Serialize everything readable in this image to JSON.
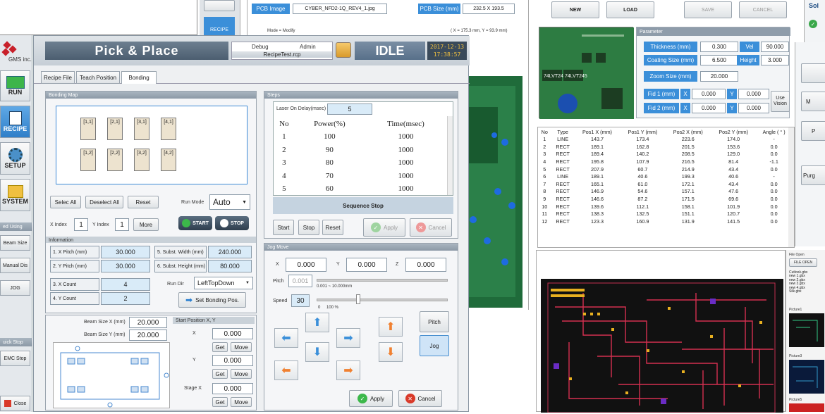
{
  "top_strip": {
    "pcb_image_label": "PCB Image",
    "pcb_image_value": "CYBER_NFD2-1Q_REV4_1.jpg",
    "pcb_size_label": "PCB Size (mm)",
    "pcb_size_value": "232.5 X 193.5",
    "mode": "Mode = Modify",
    "coords": "( X = 175.3 mm, Y = 93.9 mm)"
  },
  "left_sidebar_top": {
    "recipe": "RECIPE"
  },
  "right_toolbar": {
    "new": "NEW",
    "load": "LOAD",
    "save": "SAVE",
    "cancel": "CANCEL",
    "sol": "Sol"
  },
  "parameter": {
    "title": "Parameter",
    "thickness_label": "Thickness (mm)",
    "thickness": "0.300",
    "vel_label": "Vel",
    "vel": "90.000",
    "coating_label": "Coating Size (mm)",
    "coating": "6.500",
    "height_label": "Height",
    "height": "3.000",
    "zoom_label": "Zoom Size (mm)",
    "zoom": "20.000",
    "fid1": "Fid 1 (mm)",
    "fid2": "Fid 2 (mm)",
    "x": "X",
    "y": "Y",
    "fid1x": "0.000",
    "fid1y": "0.000",
    "fid2x": "0.000",
    "fid2y": "0.000",
    "use_vision": "Use Vision"
  },
  "coord_table": {
    "headers": [
      "No",
      "Type",
      "Pos1 X (mm)",
      "Pos1 Y (mm)",
      "Pos2 X (mm)",
      "Pos2 Y (mm)",
      "Angle ( ° )"
    ],
    "rows": [
      [
        "1",
        "LINE",
        "143.7",
        "173.4",
        "223.6",
        "174.0",
        "-"
      ],
      [
        "2",
        "RECT",
        "189.1",
        "162.8",
        "201.5",
        "153.6",
        "0.0"
      ],
      [
        "3",
        "RECT",
        "189.4",
        "140.2",
        "208.5",
        "129.0",
        "0.0"
      ],
      [
        "4",
        "RECT",
        "195.8",
        "107.9",
        "216.5",
        "81.4",
        "-1.1"
      ],
      [
        "5",
        "RECT",
        "207.9",
        "60.7",
        "214.9",
        "43.4",
        "0.0"
      ],
      [
        "6",
        "LINE",
        "189.1",
        "40.6",
        "199.3",
        "40.6",
        "-"
      ],
      [
        "7",
        "RECT",
        "165.1",
        "61.0",
        "172.1",
        "43.4",
        "0.0"
      ],
      [
        "8",
        "RECT",
        "146.9",
        "54.6",
        "157.1",
        "47.6",
        "0.0"
      ],
      [
        "9",
        "RECT",
        "146.6",
        "87.2",
        "171.5",
        "69.6",
        "0.0"
      ],
      [
        "10",
        "RECT",
        "139.6",
        "112.1",
        "158.1",
        "101.9",
        "0.0"
      ],
      [
        "11",
        "RECT",
        "138.3",
        "132.5",
        "151.1",
        "120.7",
        "0.0"
      ],
      [
        "12",
        "RECT",
        "123.3",
        "160.9",
        "131.9",
        "141.5",
        "0.0"
      ]
    ]
  },
  "far_right": {
    "m": "M",
    "p": "P",
    "purg": "Purg"
  },
  "file_panel": {
    "file_open_title": "File Open",
    "file_open_btn": "FILE OPEN",
    "files": [
      "Cutlook.gbx",
      "new 1.gbx",
      "new 2.gbx",
      "new 3.gbx",
      "new 4.gbx",
      "Silk.gbx"
    ],
    "picture1": "Picture1",
    "picture3": "Picture3",
    "picture5": "Picture5"
  },
  "main": {
    "logo": "GMS inc.",
    "title": "Pick & Place",
    "debug": "Debug",
    "admin": "Admin",
    "recipe_file": "RecipeTest.rcp",
    "status": "IDLE",
    "date": "2017-12-13",
    "time": "17:38:57",
    "tabs": [
      "Recipe File",
      "Teach Position",
      "Bonding"
    ],
    "side": {
      "run": "RUN",
      "recipe": "RECIPE",
      "setup": "SETUP",
      "system": "SYSTEM",
      "laser_unit": "ed Using",
      "beam_size": "Beam Size",
      "manual_dis": "Manual Dis",
      "jog": "JOG",
      "quick_stop": "uick Stop",
      "emc_stop": "EMC Stop",
      "close": "Close"
    },
    "bonding_map": {
      "title": "Bonding Map",
      "cells": [
        "[1,1]",
        "[2,1]",
        "[3,1]",
        "[4,1]",
        "[1,2]",
        "[2,2]",
        "[3,2]",
        "[4,2]"
      ],
      "select_all": "Selec All",
      "deselect_all": "Deselect All",
      "reset": "Reset",
      "run_mode_label": "Run Mode",
      "run_mode": "Auto",
      "x_index_label": "X Index",
      "x_index": "1",
      "y_index_label": "Y Index",
      "y_index": "1",
      "more": "More",
      "start": "START",
      "stop": "STOP"
    },
    "information": {
      "title": "Information",
      "x_pitch_label": "1. X Pitch (mm)",
      "x_pitch": "30.000",
      "y_pitch_label": "2. Y Pitch (mm)",
      "y_pitch": "30.000",
      "x_count_label": "3. X Count",
      "x_count": "4",
      "y_count_label": "4. Y Count",
      "y_count": "2",
      "subst_w_label": "5. Subst. Width (mm)",
      "subst_w": "240.000",
      "subst_h_label": "6. Subst. Height (mm)",
      "subst_h": "80.000",
      "run_dir_label": "Run Dir",
      "run_dir": "LeftTopDown",
      "set_bonding": "Set Bonding Pos."
    },
    "beam": {
      "beam_x_label": "Beam Size X (mm)",
      "beam_x": "20.000",
      "beam_y_label": "Beam Size Y (mm)",
      "beam_y": "20.000",
      "start_pos_title": "Start Position X, Y",
      "x": "X",
      "y": "Y",
      "start_x": "0.000",
      "start_y": "0.000",
      "stage_x_label": "Stage X",
      "stage_x": "0.000",
      "get": "Get",
      "move": "Move"
    },
    "steps": {
      "title": "Steps",
      "laser_delay_label": "Laser On Delay(msec)",
      "laser_delay": "5",
      "headers": [
        "No",
        "Power(%)",
        "Time(msec)"
      ],
      "rows": [
        [
          "1",
          "100",
          "1000"
        ],
        [
          "2",
          "90",
          "1000"
        ],
        [
          "3",
          "80",
          "1000"
        ],
        [
          "4",
          "70",
          "1000"
        ],
        [
          "5",
          "60",
          "1000"
        ]
      ],
      "sequence_stop": "Sequence Stop",
      "start": "Start",
      "stop": "Stop",
      "reset": "Reset",
      "apply": "Apply",
      "cancel": "Cancel"
    },
    "jog_move": {
      "title": "Jog Move",
      "x": "X",
      "y": "Y",
      "z": "Z",
      "xv": "0.000",
      "yv": "0.000",
      "zv": "0.000",
      "pitch_label": "Pitch",
      "pitch": "0.001",
      "pitch_range": "0.001 ~ 10.000mm",
      "speed_label": "Speed",
      "speed": "30",
      "speed_range": "0",
      "speed_max": "100 %",
      "pitch_btn": "Pitch",
      "jog_btn": "Jog",
      "apply": "Apply",
      "cancel": "Cancel"
    }
  }
}
